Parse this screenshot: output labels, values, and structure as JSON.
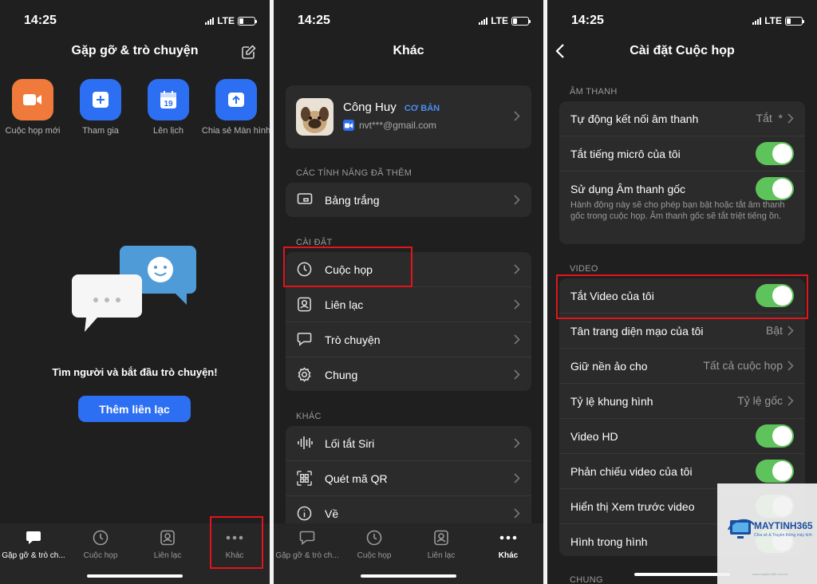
{
  "status": {
    "time": "14:25",
    "network": "LTE"
  },
  "screen1": {
    "title": "Gặp gỡ & trò chuyện",
    "actions": [
      {
        "label": "Cuộc họp mới",
        "color": "#f07a3c",
        "icon": "video-camera-icon"
      },
      {
        "label": "Tham gia",
        "color": "#2d6ff2",
        "icon": "plus-icon"
      },
      {
        "label": "Lên lịch",
        "color": "#2d6ff2",
        "icon": "calendar-icon",
        "day": "19"
      },
      {
        "label": "Chia sẻ Màn hình",
        "color": "#2d6ff2",
        "icon": "share-up-arrow-icon"
      }
    ],
    "empty_text": "Tìm người và bắt đầu trò chuyện!",
    "add_contact_button": "Thêm liên lạc",
    "tabs": [
      "Gặp gỡ & trò ch...",
      "Cuộc họp",
      "Liên lạc",
      "Khác"
    ]
  },
  "screen2": {
    "title": "Khác",
    "profile": {
      "name": "Công Huy",
      "badge": "CƠ BẢN",
      "email": "nvt***@gmail.com"
    },
    "section_features": "CÁC TÍNH NĂNG ĐÃ THÊM",
    "whiteboard": "Bảng trắng",
    "section_settings": "CÀI ĐẶT",
    "settings_items": [
      "Cuộc họp",
      "Liên lạc",
      "Trò chuyện",
      "Chung"
    ],
    "section_other": "KHÁC",
    "other_items": [
      "Lối tắt Siri",
      "Quét mã QR",
      "Về"
    ],
    "tabs": [
      "Gặp gỡ & trò ch...",
      "Cuộc họp",
      "Liên lạc",
      "Khác"
    ]
  },
  "screen3": {
    "title": "Cài đặt Cuộc họp",
    "section_audio": "ÂM THANH",
    "auto_connect_audio": "Tự động kết nối âm thanh",
    "auto_connect_value": "Tắt",
    "auto_connect_mark": "*",
    "mute_mic": "Tắt tiếng micrô của tôi",
    "original_sound": "Sử dụng Âm thanh gốc",
    "original_sound_note": "Hành động này sẽ cho phép bạn bật hoặc tắt âm thanh gốc trong cuộc họp. Âm thanh gốc sẽ tắt triệt tiếng ồn.",
    "section_video": "VIDEO",
    "turn_off_video": "Tắt Video của tôi",
    "touch_up": "Tân trang diện mạo của tôi",
    "touch_up_value": "Bật",
    "keep_bg": "Giữ nền ảo cho",
    "keep_bg_value": "Tất cả cuộc họp",
    "aspect_ratio": "Tỷ lệ khung hình",
    "aspect_ratio_value": "Tỷ lệ gốc",
    "hd_video": "Video HD",
    "mirror_video": "Phản chiếu video của tôi",
    "preview_video": "Hiển thị Xem trước video",
    "pip": "Hình trong hình",
    "section_general": "CHUNG"
  },
  "watermark": {
    "brand": "MAYTINH365",
    "tagline": "Chia sẻ & Truyền thông máy tính",
    "site": "www.maytinh365.com.vn"
  }
}
